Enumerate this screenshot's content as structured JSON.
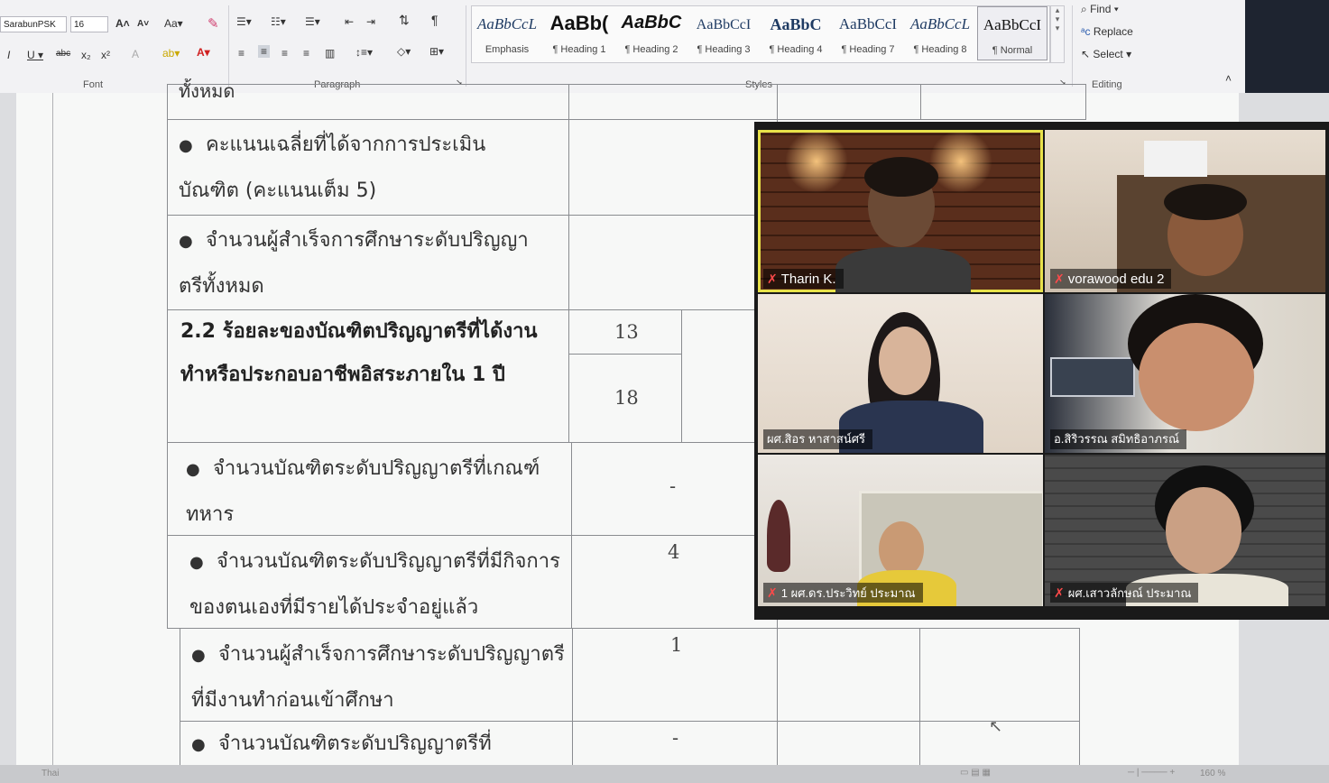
{
  "ribbon": {
    "font_name": "SarabunPSK",
    "font_size": "16",
    "font_group_label": "Font",
    "paragraph_group_label": "Paragraph",
    "styles_group_label": "Styles",
    "editing_group_label": "Editing",
    "styles": [
      {
        "sample": "AaBbCcL",
        "name": "Emphasis"
      },
      {
        "sample": "AaBb(",
        "name": "¶ Heading 1"
      },
      {
        "sample": "AaBbC",
        "name": "¶ Heading 2"
      },
      {
        "sample": "AaBbCcI",
        "name": "¶ Heading 3"
      },
      {
        "sample": "AaBbC",
        "name": "¶ Heading 4"
      },
      {
        "sample": "AaBbCcI",
        "name": "¶ Heading 7"
      },
      {
        "sample": "AaBbCcL",
        "name": "¶ Heading 8"
      },
      {
        "sample": "AaBbCcI",
        "name": "¶ Normal"
      }
    ],
    "editing": {
      "find": "Find",
      "replace": "Replace",
      "select": "Select"
    }
  },
  "document": {
    "top_partial": "ทั้งหมด",
    "rows": [
      {
        "text": "คะแนนเฉลี่ยที่ได้จากการประเมินบัณฑิต (คะแนนเต็ม 5)",
        "bullet": true,
        "value": ""
      },
      {
        "text": "จำนวนผู้สำเร็จการศึกษาระดับปริญญาตรีทั้งหมด",
        "bullet": true,
        "value": ""
      },
      {
        "text": "2.2 ร้อยละของบัณฑิตปริญญาตรีที่ได้งานทำหรือประกอบอาชีพอิสระภายใน 1 ปี",
        "bullet": false,
        "bold": true,
        "value_top": "13",
        "value_bottom": "18"
      },
      {
        "text": "จำนวนบัณฑิตระดับปริญญาตรีที่เกณฑ์ทหาร",
        "bullet": true,
        "value": "-"
      },
      {
        "text": "จำนวนบัณฑิตระดับปริญญาตรีที่มีกิจการของตนเองที่มีรายได้ประจำอยู่แล้ว",
        "bullet": true,
        "value": "4"
      },
      {
        "text": "จำนวนผู้สำเร็จการศึกษาระดับปริญญาตรีที่มีงานทำก่อนเข้าศึกษา",
        "bullet": true,
        "value": "1"
      },
      {
        "text": "จำนวนบัณฑิตระดับปริญญาตรีที่",
        "bullet": true,
        "value": "-"
      }
    ]
  },
  "status": {
    "language": "Thai",
    "zoom": "160 %"
  },
  "participants": [
    {
      "name": "Tharin K.",
      "active": true
    },
    {
      "name": "vorawood edu 2",
      "active": false
    },
    {
      "name": "ผศ.สิอร หาสาสน์ศรี",
      "active": false
    },
    {
      "name": "อ.สิริวรรณ สมิทธิอาภรณ์",
      "active": false
    },
    {
      "name": "1 ผศ.ดร.ประวิทย์ ประมาณ",
      "active": false
    },
    {
      "name": "ผศ.เสาวลักษณ์ ประมาณ",
      "active": false
    }
  ],
  "colors": {
    "active_border": "#e8e24a",
    "mute": "#ff4a4a"
  }
}
